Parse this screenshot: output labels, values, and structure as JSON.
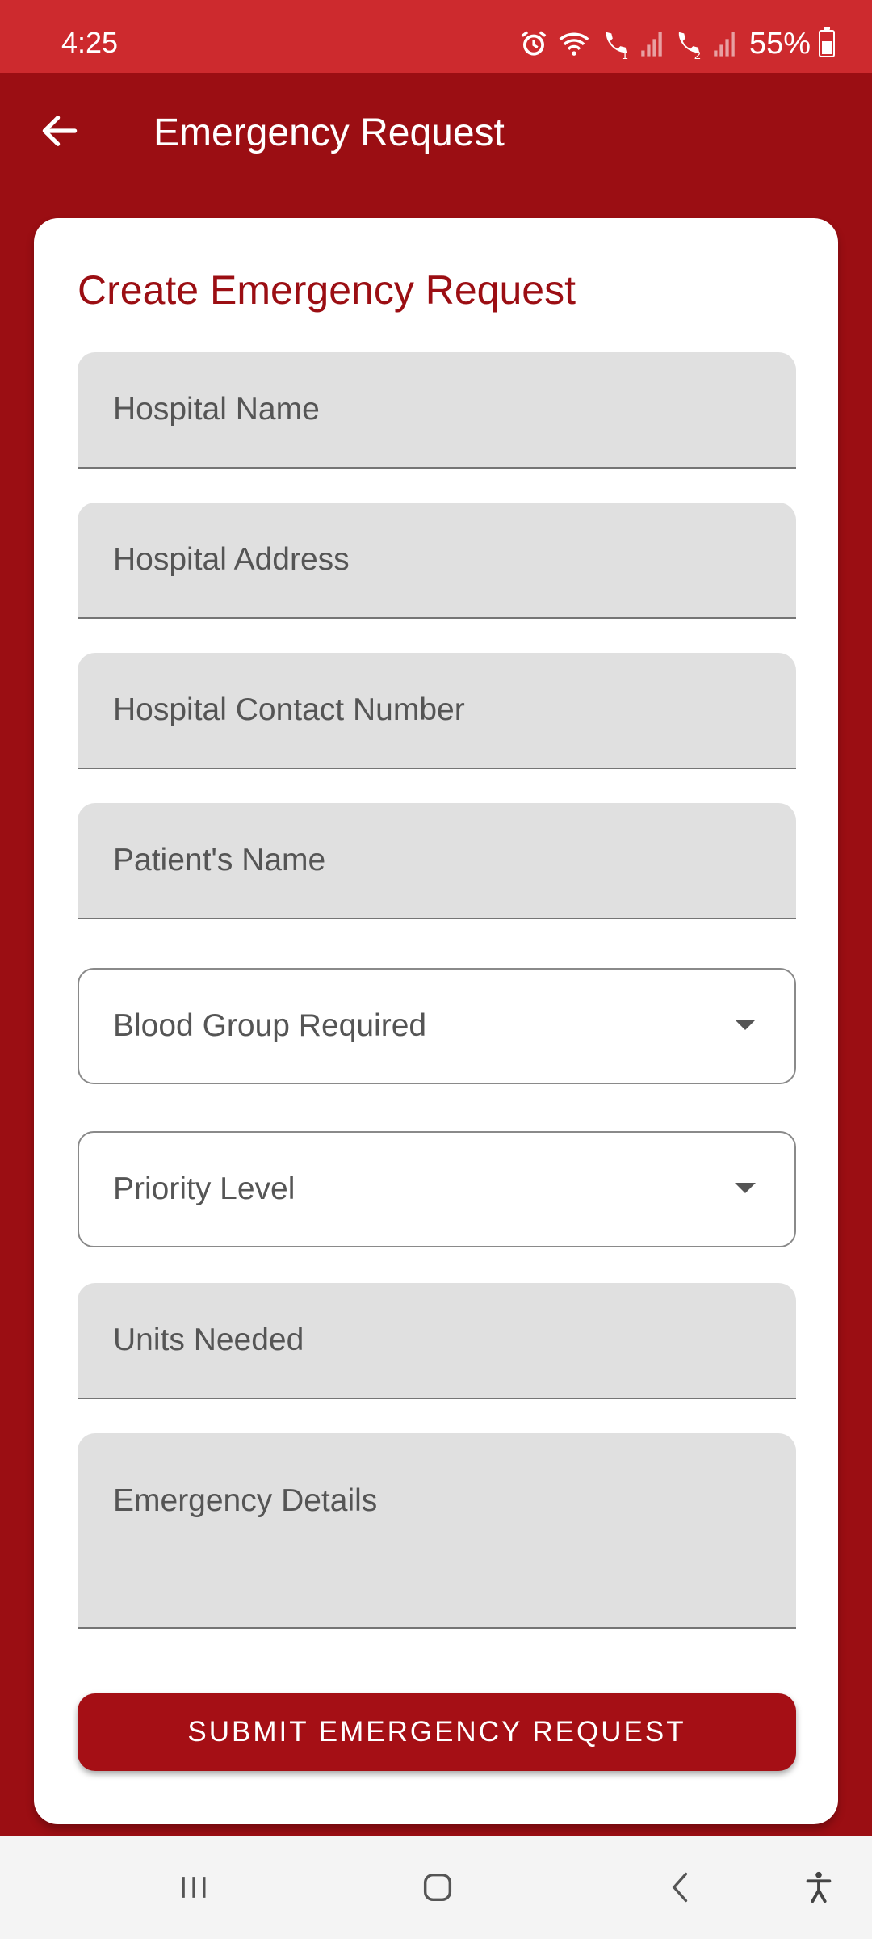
{
  "status_bar": {
    "time": "4:25",
    "battery": "55%",
    "icons": [
      "alarm-icon",
      "wifi-icon",
      "call-sim1-icon",
      "signal-icon",
      "call-sim2-icon",
      "signal-icon"
    ]
  },
  "app_bar": {
    "title": "Emergency Request",
    "back_icon": "arrow-left-icon"
  },
  "form": {
    "heading": "Create Emergency Request",
    "hospital_name_placeholder": "Hospital Name",
    "hospital_address_placeholder": "Hospital Address",
    "hospital_contact_placeholder": "Hospital Contact Number",
    "patient_name_placeholder": "Patient's Name",
    "blood_group_label": "Blood Group Required",
    "priority_label": "Priority Level",
    "units_placeholder": "Units Needed",
    "details_placeholder": "Emergency Details",
    "submit_label": "SUBMIT EMERGENCY REQUEST"
  },
  "colors": {
    "primary": "#9b0e13",
    "status_bar": "#cd2a2e",
    "field_bg": "#e0e0e0"
  },
  "nav_bar": {
    "items": [
      "recent-apps-icon",
      "home-icon",
      "back-icon",
      "accessibility-icon"
    ]
  }
}
